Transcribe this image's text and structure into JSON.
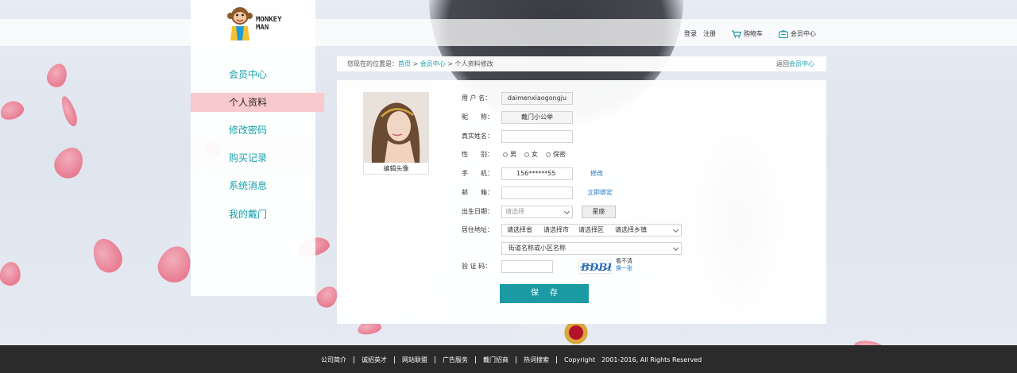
{
  "brand": {
    "logo_line1": "MONKEY",
    "logo_line2": "MAN"
  },
  "top_nav": {
    "login": "登录",
    "register": "注册",
    "cart": "购物车",
    "member_center": "会员中心"
  },
  "sidebar": {
    "items": [
      {
        "label": "会员中心"
      },
      {
        "label": "个人资料",
        "active": true
      },
      {
        "label": "修改密码"
      },
      {
        "label": "购买记录"
      },
      {
        "label": "系统消息"
      },
      {
        "label": "我的戴门"
      }
    ]
  },
  "breadcrumb": {
    "prefix": "您现在的位置是：",
    "home": "首页",
    "sep": " > ",
    "member": "会员中心",
    "current": "个人资料修改",
    "back_prefix": "返回",
    "back_link": "会员中心"
  },
  "avatar": {
    "caption": "编辑头像"
  },
  "form": {
    "username": {
      "label": "用 户 名：",
      "value": "daimenxiaogongju"
    },
    "nickname": {
      "label": "昵　　称：",
      "value": "戴门小公举"
    },
    "realname": {
      "label": "真实姓名：",
      "value": ""
    },
    "gender": {
      "label": "性　　别：",
      "options": [
        "男",
        "女",
        "保密"
      ]
    },
    "phone": {
      "label": "手　　机：",
      "value": "156******55",
      "action": "修改"
    },
    "email": {
      "label": "邮　　箱：",
      "value": "",
      "action": "立即绑定"
    },
    "birthday": {
      "label": "出生日期：",
      "placeholder": "请选择",
      "zodiac_button": "星座"
    },
    "address": {
      "label": "居住地址：",
      "province": "请选择省",
      "city": "请选择市",
      "district": "请选择区",
      "town": "请选择乡镇",
      "street": "街道名称或小区名称"
    },
    "captcha": {
      "label": "验 证 码：",
      "image_text": "BDBE",
      "refresh_line1": "看不清",
      "refresh_line2": "换一张"
    },
    "save_button": "保存"
  },
  "footer": {
    "items": [
      "公司简介",
      "诚招英才",
      "网站联盟",
      "广告服务",
      "戴门招商",
      "热词搜索"
    ],
    "copyright": "Copyright　2001-2016, All Rights Reserved"
  },
  "colors": {
    "accent": "#1a9aa3",
    "link": "#1a78c8",
    "active_bg": "#f8c9cd",
    "footer_bg": "#2b2b2b"
  }
}
